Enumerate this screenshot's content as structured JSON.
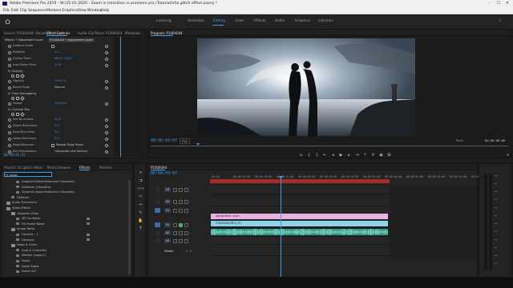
{
  "window": {
    "title": "Adobe Premiere Pro 2019 - W:\\25-01-2020 - Zoom in transition in premiere pro (Tutorial)\\rhz glitch effect.prproj *",
    "controls": [
      "–",
      "☐",
      "✕"
    ]
  },
  "menubar": [
    "File",
    "Edit",
    "Clip",
    "Sequence",
    "Markers",
    "Graphics",
    "View",
    "Window",
    "Help"
  ],
  "workspaces": {
    "tabs": [
      "Learning",
      "Assembly",
      "Editing",
      "Color",
      "Effects",
      "Audio",
      "Graphics",
      "Libraries"
    ],
    "active": "Editing"
  },
  "effect_controls": {
    "tabs": [
      "Source: P1004044: Adjustment Layer",
      "Effect Controls",
      "Audio Clip Mixer: P1004044",
      "Metadata"
    ],
    "active_tab": "Effect Controls",
    "source_label": "Master * Adjustment Layer",
    "clip_label": "P1004044 * Adjustment Layer",
    "rows": [
      {
        "label": "Uniform Scale",
        "value": "",
        "check": true
      },
      {
        "label": "Rotation",
        "value": "0.0"
      },
      {
        "label": "Anchor Point",
        "value": "960.0   540.0"
      },
      {
        "label": "Anti-flicker Filter",
        "value": "0.00"
      },
      {
        "label": "Opacity",
        "value": "",
        "header": true
      },
      {
        "label": "Opacity",
        "value": "100.0 %"
      },
      {
        "label": "Blend Mode",
        "value": "Normal"
      },
      {
        "label": "Time Remapping",
        "value": "",
        "header": true
      },
      {
        "label": "Speed",
        "value": "100.00%"
      },
      {
        "label": "Channel Blur",
        "value": "",
        "header": true
      },
      {
        "label": "Red Blurriness",
        "value": "40.0"
      },
      {
        "label": "Green Blurriness",
        "value": "0.0"
      },
      {
        "label": "Blue Blurriness",
        "value": "0.0"
      },
      {
        "label": "Alpha Blurriness",
        "value": "0.0"
      },
      {
        "label": "Edge Behavior",
        "value": "Repeat Edge Pixels",
        "check": true
      },
      {
        "label": "Blur Dimensions",
        "value": "Horizontal and Vertical"
      }
    ],
    "timecode": "00:00:03:07"
  },
  "program": {
    "tab": "Program: P1004044",
    "timecode": "00:00:03:07",
    "fit": "Fit",
    "quality": "Full",
    "duration": "00:00:08:08"
  },
  "effects_panel": {
    "tabs": [
      "Project: rhz glitch effect",
      "Media Browser",
      "Effects",
      "Markers"
    ],
    "active_tab": "Effects",
    "search_value": "noise",
    "items": [
      {
        "label": "Adaptive Noise Reduction (Obsolete)",
        "indent": 2,
        "type": "fx"
      },
      {
        "label": "DeNoiser (Obsolete)",
        "indent": 2,
        "type": "fx"
      },
      {
        "label": "Dynamic Noise Reduction (Obsolete)",
        "indent": 2,
        "type": "fx"
      },
      {
        "label": "DeNoise",
        "indent": 1,
        "type": "fx"
      },
      {
        "label": "Audio Transitions",
        "indent": 0,
        "type": "folder"
      },
      {
        "label": "Video Effects",
        "indent": 0,
        "type": "folder"
      },
      {
        "label": "Obsolete Video",
        "indent": 1,
        "type": "folder"
      },
      {
        "label": "3D Cor Noise",
        "indent": 2,
        "type": "fx"
      },
      {
        "label": "HS Frame Noise",
        "indent": 2,
        "type": "fx"
      },
      {
        "label": "Image Noise",
        "indent": 1,
        "type": "folder"
      },
      {
        "label": "Denoise - 1",
        "indent": 2,
        "type": "fx"
      },
      {
        "label": "Denoiser",
        "indent": 2,
        "type": "fx"
      },
      {
        "label": "Noise & Grain",
        "indent": 1,
        "type": "folder"
      },
      {
        "label": "Dust & Scratches",
        "indent": 2,
        "type": "fx"
      },
      {
        "label": "Median (Legacy)",
        "indent": 2,
        "type": "fx"
      },
      {
        "label": "Noise",
        "indent": 2,
        "type": "fx"
      },
      {
        "label": "Noise Alpha",
        "indent": 2,
        "type": "fx"
      },
      {
        "label": "Noise HLS",
        "indent": 2,
        "type": "fx"
      }
    ]
  },
  "timeline": {
    "tab": "P1004044",
    "timecode": "00:00:03:07",
    "ruler": [
      "00:00",
      "00:00:05:00",
      "00:00:10:00",
      "00:00:15:00",
      "00:00:20:00",
      "00:00:25:00",
      "00:00:30:00",
      "00:00:35:00",
      "00:00:40:00",
      "00:00:45:00",
      "00:00:50:00",
      "00:00:55:00",
      "00:01:00:00"
    ],
    "tracks": [
      "V3",
      "V2",
      "V1",
      "A1",
      "A2",
      "A3",
      "Master"
    ],
    "master_value": "0.0",
    "clips": {
      "v2": "Adjustment Layer",
      "v1": "P1004044.MP4 [V]"
    }
  },
  "colors": {
    "accent": "#3d9be9",
    "adjustment_clip": "#e8b4e6",
    "video_clip": "#8fd3e8",
    "audio_clip": "#2f9d8b"
  }
}
